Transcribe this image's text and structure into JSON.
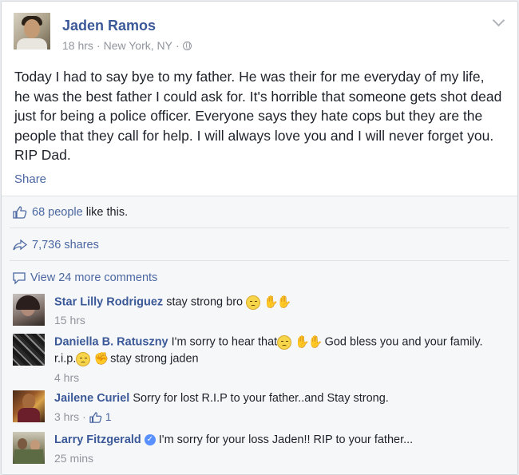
{
  "post": {
    "author": "Jaden Ramos",
    "time": "18 hrs",
    "separator": "·",
    "location": "New York, NY",
    "separator2": "·",
    "text": "Today I had to say bye to my father. He was their for me everyday of my life, he was the best father I could ask for. It's horrible that someone gets shot dead just for being a police officer. Everyone says they hate cops but they are the people that they call for help. I will always love you and I will never forget you. RIP Dad.",
    "share_label": "Share"
  },
  "likes": {
    "count_text": "68 people",
    "suffix": " like this."
  },
  "shares": {
    "text": "7,736 shares"
  },
  "view_more": {
    "text": "View 24 more comments"
  },
  "comments": [
    {
      "name": "Star Lilly Rodriguez",
      "text": "stay strong bro",
      "time": "15 hrs"
    },
    {
      "name": "Daniella B. Ratuszny",
      "text_a": "I'm sorry to hear that",
      "text_b": "God bless you and your family. r.i.p.",
      "text_c": "stay strong jaden",
      "time": "4 hrs"
    },
    {
      "name": "Jailene Curiel",
      "text": "Sorry for lost R.I.P to your father..and Stay strong.",
      "time": "3 hrs",
      "sep": "·",
      "likes": "1"
    },
    {
      "name": "Larry Fitzgerald",
      "text": "I'm sorry for your loss Jaden!! RIP to your father...",
      "time": "25 mins"
    }
  ],
  "icons": {
    "chevron": "chevron-down-icon",
    "globe": "globe-icon",
    "like": "thumbs-up-icon",
    "share": "share-arrow-icon",
    "comment": "comment-bubble-icon",
    "verified": "verified-badge-icon"
  },
  "colors": {
    "link": "#3b5998",
    "muted": "#90949c",
    "background": "#f6f7f9"
  }
}
